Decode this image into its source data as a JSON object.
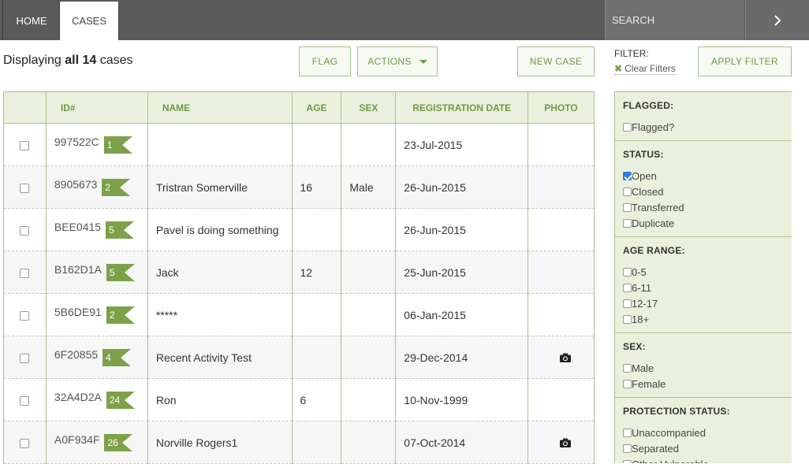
{
  "nav": {
    "home": "HOME",
    "cases": "CASES",
    "search_placeholder": "SEARCH"
  },
  "toolbar": {
    "displaying_prefix": "Displaying",
    "displaying_all": "all 14",
    "displaying_suffix": "cases",
    "flag": "FLAG",
    "actions": "ACTIONS",
    "new_case": "NEW CASE",
    "filter_label": "FILTER:",
    "clear_filters": "Clear Filters",
    "apply_filter": "APPLY FILTER"
  },
  "table": {
    "headers": [
      "ID#",
      "NAME",
      "AGE",
      "SEX",
      "REGISTRATION DATE",
      "PHOTO"
    ],
    "rows": [
      {
        "id": "997522C",
        "flags": "1",
        "name": "",
        "age": "",
        "sex": "",
        "date": "23-Jul-2015",
        "photo": false
      },
      {
        "id": "8905673",
        "flags": "2",
        "name": "Tristran Somerville",
        "age": "16",
        "sex": "Male",
        "date": "26-Jun-2015",
        "photo": false
      },
      {
        "id": "BEE0415",
        "flags": "5",
        "name": "Pavel is doing something",
        "age": "",
        "sex": "",
        "date": "26-Jun-2015",
        "photo": false
      },
      {
        "id": "B162D1A",
        "flags": "5",
        "name": "Jack",
        "age": "12",
        "sex": "",
        "date": "25-Jun-2015",
        "photo": false
      },
      {
        "id": "5B6DE91",
        "flags": "2",
        "name": "*****",
        "age": "",
        "sex": "",
        "date": "06-Jan-2015",
        "photo": false
      },
      {
        "id": "6F20855",
        "flags": "4",
        "name": "Recent Activity Test",
        "age": "",
        "sex": "",
        "date": "29-Dec-2014",
        "photo": true
      },
      {
        "id": "32A4D2A",
        "flags": "24",
        "name": "Ron",
        "age": "6",
        "sex": "",
        "date": "10-Nov-1999",
        "photo": false
      },
      {
        "id": "A0F934F",
        "flags": "26",
        "name": "Norville Rogers1",
        "age": "",
        "sex": "",
        "date": "07-Oct-2014",
        "photo": true
      }
    ]
  },
  "filters": {
    "flagged": {
      "title": "FLAGGED:",
      "options": [
        {
          "label": "Flagged?",
          "checked": false
        }
      ]
    },
    "status": {
      "title": "STATUS:",
      "options": [
        {
          "label": "Open",
          "checked": true
        },
        {
          "label": "Closed",
          "checked": false
        },
        {
          "label": "Transferred",
          "checked": false
        },
        {
          "label": "Duplicate",
          "checked": false
        }
      ]
    },
    "age_range": {
      "title": "AGE RANGE:",
      "options": [
        {
          "label": "0-5",
          "checked": false
        },
        {
          "label": "6-11",
          "checked": false
        },
        {
          "label": "12-17",
          "checked": false
        },
        {
          "label": "18+",
          "checked": false
        }
      ]
    },
    "sex": {
      "title": "SEX:",
      "options": [
        {
          "label": "Male",
          "checked": false
        },
        {
          "label": "Female",
          "checked": false
        }
      ]
    },
    "protection_status": {
      "title": "PROTECTION STATUS:",
      "options": [
        {
          "label": "Unaccompanied",
          "checked": false
        },
        {
          "label": "Separated",
          "checked": false
        },
        {
          "label": "Other Vulnerable",
          "checked": false
        }
      ]
    }
  },
  "colors": {
    "accent_green": "#6f9a45",
    "topbar": "#5a5a5a",
    "panel": "#eaf0dd",
    "checkbox_checked": "#2b7de0"
  }
}
